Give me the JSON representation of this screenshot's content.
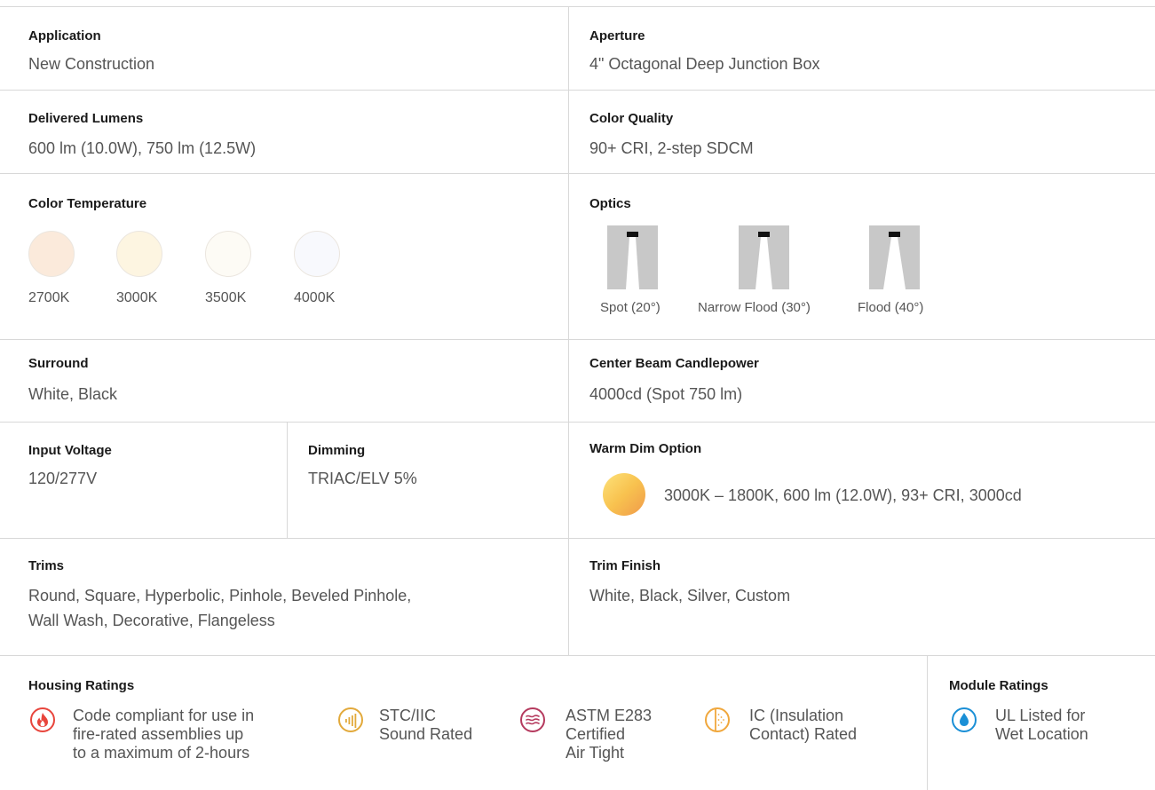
{
  "specs": {
    "application": {
      "label": "Application",
      "value": "New Construction"
    },
    "aperture": {
      "label": "Aperture",
      "value": "4\" Octagonal Deep Junction Box"
    },
    "delivered_lumens": {
      "label": "Delivered Lumens",
      "value": "600 lm (10.0W), 750 lm (12.5W)"
    },
    "color_quality": {
      "label": "Color Quality",
      "value": "90+ CRI, 2-step SDCM"
    },
    "color_temperature": {
      "label": "Color Temperature",
      "swatches": [
        {
          "label": "2700K",
          "color": "#fbeadb"
        },
        {
          "label": "3000K",
          "color": "#fdf5e1"
        },
        {
          "label": "3500K",
          "color": "#fdfbf5"
        },
        {
          "label": "4000K",
          "color": "#f8f9fd"
        }
      ]
    },
    "optics": {
      "label": "Optics",
      "items": [
        {
          "label": "Spot (20°)",
          "beam_angle_deg": 20
        },
        {
          "label": "Narrow Flood (30°)",
          "beam_angle_deg": 30
        },
        {
          "label": "Flood (40°)",
          "beam_angle_deg": 40
        }
      ]
    },
    "surround": {
      "label": "Surround",
      "value": "White, Black"
    },
    "center_beam_candlepower": {
      "label": "Center Beam Candlepower",
      "value": "4000cd (Spot 750 lm)"
    },
    "input_voltage": {
      "label": "Input Voltage",
      "value": "120/277V"
    },
    "dimming": {
      "label": "Dimming",
      "value": "TRIAC/ELV 5%"
    },
    "warm_dim_option": {
      "label": "Warm Dim Option",
      "value": "3000K – 1800K, 600 lm (12.0W), 93+ CRI, 3000cd"
    },
    "trims": {
      "label": "Trims",
      "value_line1": "Round, Square, Hyperbolic, Pinhole, Beveled Pinhole,",
      "value_line2": "Wall Wash, Decorative, Flangeless"
    },
    "trim_finish": {
      "label": "Trim Finish",
      "value": "White, Black, Silver, Custom"
    }
  },
  "housing_ratings": {
    "label": "Housing Ratings",
    "items": [
      {
        "icon": "flame-icon",
        "color": "#e8453c",
        "text": "Code compliant for use in\nfire-rated assemblies up\nto a maximum of 2-hours"
      },
      {
        "icon": "sound-icon",
        "color": "#e2a93b",
        "text": "STC/IIC\nSound Rated"
      },
      {
        "icon": "air-icon",
        "color": "#b53a5e",
        "text": "ASTM E283\nCertified\nAir Tight"
      },
      {
        "icon": "insulation-icon",
        "color": "#f0a73c",
        "text": "IC (Insulation\nContact) Rated"
      }
    ]
  },
  "module_ratings": {
    "label": "Module Ratings",
    "items": [
      {
        "icon": "water-drop-icon",
        "color": "#1a8fd6",
        "text": "UL Listed for\nWet Location"
      }
    ]
  }
}
